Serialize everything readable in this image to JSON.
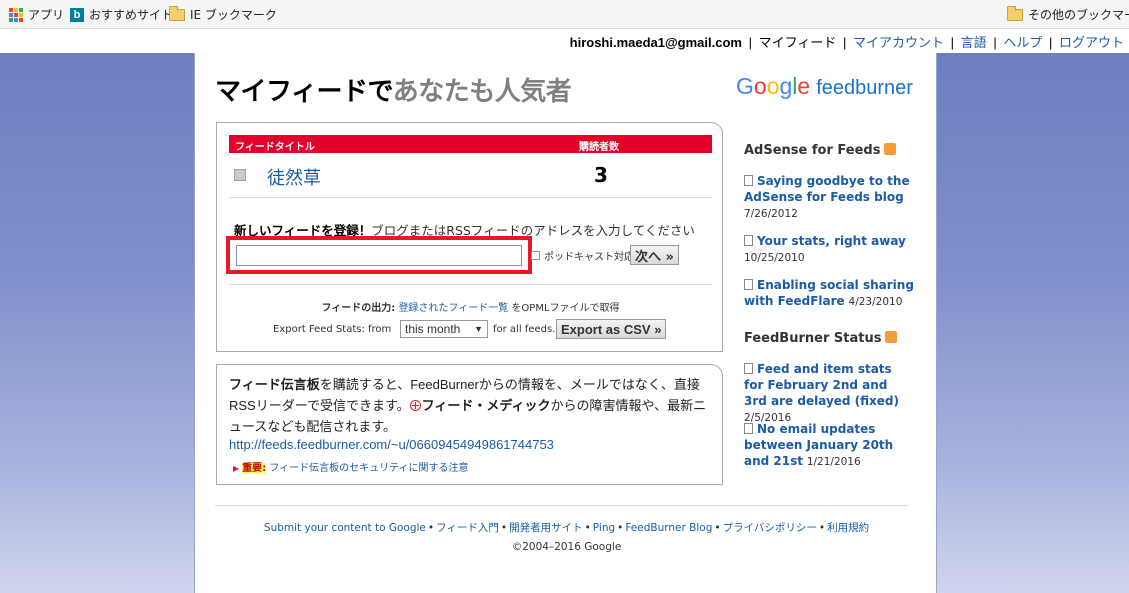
{
  "bookmarks": {
    "apps_label": "アプリ",
    "recommended_label": "おすすめサイト",
    "ie_bookmarks_label": "IE ブックマーク",
    "other_label": "その他のブックマーク"
  },
  "user_bar": {
    "email": "hiroshi.maeda1@gmail.com",
    "my_feeds": "マイフィード",
    "my_account": "マイアカウント",
    "language": "言語",
    "help": "ヘルプ",
    "logout": "ログアウト",
    "separator": "|"
  },
  "headline": {
    "part1": "マイフィードで",
    "part2": "あなたも人気者"
  },
  "logo": {
    "google": [
      "G",
      "o",
      "o",
      "g",
      "l",
      "e"
    ],
    "feedburner": "feedburner"
  },
  "feeds": {
    "header_title": "フィードタイトル",
    "header_subscribers": "購読者数",
    "rows": [
      {
        "title": "徒然草",
        "subscribers": "3"
      }
    ],
    "new_feed_bold": "新しいフィードを登録！",
    "new_feed_rest": "ブログまたはRSSフィードのアドレスを入力してください",
    "input_value": "",
    "podcast_label": "ポッドキャスト対応",
    "next_button": "次へ »",
    "output_label": "フィードの出力:",
    "output_link": "登録されたフィード一覧",
    "output_suffix": "をOPMLファイルで取得",
    "export_label": "Export Feed Stats: from",
    "export_period": "this month",
    "export_suffix": "for all feeds.",
    "export_button": "Export as CSV »"
  },
  "relay": {
    "bold1": "フィード伝言板",
    "text1": "を購読すると、FeedBurnerからの情報を、メールではなく、直接RSSリーダーで受信できます。",
    "bold2": "フィード・メディック",
    "text2": "からの障害情報や、最新ニュースなども配信されます。",
    "url": "http://feeds.feedburner.com/~u/06609454949861744753",
    "notice_label": "重要:",
    "notice_link": "フィード伝言板のセキュリティに関する注意"
  },
  "sidebar": {
    "adsense_heading": "AdSense for Feeds",
    "adsense_items": [
      {
        "title": "Saying goodbye to the AdSense for Feeds blog",
        "date": "7/26/2012"
      },
      {
        "title": "Your stats, right away",
        "date": "10/25/2010"
      },
      {
        "title": "Enabling social sharing with FeedFlare",
        "date": "4/23/2010"
      }
    ],
    "status_heading": "FeedBurner Status",
    "status_items": [
      {
        "title": "Feed and item stats for February 2nd and 3rd are delayed (fixed)",
        "date": "2/5/2016"
      },
      {
        "title": "No email updates between January 20th and 21st",
        "date": "1/21/2016"
      }
    ]
  },
  "footer": {
    "links": [
      "Submit your content to Google",
      "フィード入門",
      "開発者用サイト",
      "Ping",
      "FeedBurner Blog",
      "プライバシポリシー",
      "利用規約"
    ],
    "dot": "•",
    "copyright": "©2004–2016 Google"
  },
  "colors": {
    "accent_red": "#e4002b",
    "link_blue": "#1a5ca8",
    "side_blue": "#7f8fcb",
    "rss_orange": "#f49b38"
  }
}
